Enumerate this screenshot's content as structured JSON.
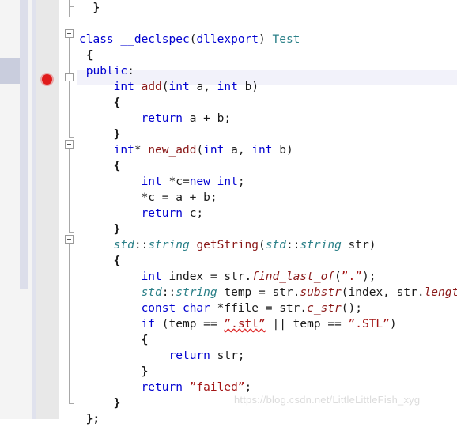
{
  "editor": {
    "app": "visual-studio-code-editor",
    "language": "C++",
    "current_line_index": 4,
    "colors": {
      "background": "#ffffff",
      "keyword": "#0000d0",
      "function_name": "#8b1a1a",
      "class_name": "#2b8088",
      "type_italic": "#2b8088",
      "string": "#a31515",
      "plain": "#1a1a1a",
      "current_line_bg": "#f2f2fa",
      "breakpoint": "#e01b1b",
      "gutter": "#e8e8e8",
      "error_squiggle": "#e03030",
      "watermark": "#dcdcdc"
    }
  },
  "gutter": {
    "breakpoint_tooltip": "Breakpoint",
    "fold_markers": [
      {
        "name": "fold-class-test",
        "label": "-"
      },
      {
        "name": "fold-method-add",
        "label": "-"
      },
      {
        "name": "fold-method-new-add",
        "label": "-"
      },
      {
        "name": "fold-method-getstring",
        "label": "-"
      }
    ]
  },
  "code_lines": [
    {
      "indent": "  ",
      "tokens": [
        {
          "t": "}",
          "c": "brace"
        }
      ]
    },
    {
      "indent": "",
      "tokens": []
    },
    {
      "indent": "",
      "tokens": [
        {
          "t": "class",
          "c": "kw"
        },
        {
          "t": " ",
          "c": "pln"
        },
        {
          "t": "__declspec",
          "c": "kw"
        },
        {
          "t": "(",
          "c": "pln"
        },
        {
          "t": "dllexport",
          "c": "kw"
        },
        {
          "t": ") ",
          "c": "pln"
        },
        {
          "t": "Test",
          "c": "cls"
        }
      ]
    },
    {
      "indent": " ",
      "tokens": [
        {
          "t": "{",
          "c": "brace"
        }
      ]
    },
    {
      "indent": " ",
      "tokens": [
        {
          "t": "public",
          "c": "kw"
        },
        {
          "t": ":",
          "c": "pln"
        }
      ]
    },
    {
      "indent": "     ",
      "tokens": [
        {
          "t": "int",
          "c": "kw"
        },
        {
          "t": " ",
          "c": "pln"
        },
        {
          "t": "add",
          "c": "fn"
        },
        {
          "t": "(",
          "c": "pln"
        },
        {
          "t": "int",
          "c": "kw"
        },
        {
          "t": " a, ",
          "c": "pln"
        },
        {
          "t": "int",
          "c": "kw"
        },
        {
          "t": " b)",
          "c": "pln"
        }
      ]
    },
    {
      "indent": "     ",
      "tokens": [
        {
          "t": "{",
          "c": "brace"
        }
      ]
    },
    {
      "indent": "         ",
      "tokens": [
        {
          "t": "return",
          "c": "kw"
        },
        {
          "t": " a + b;",
          "c": "pln"
        }
      ]
    },
    {
      "indent": "     ",
      "tokens": [
        {
          "t": "}",
          "c": "brace"
        }
      ]
    },
    {
      "indent": "     ",
      "tokens": [
        {
          "t": "int",
          "c": "kw"
        },
        {
          "t": "* ",
          "c": "pln"
        },
        {
          "t": "new_add",
          "c": "fn"
        },
        {
          "t": "(",
          "c": "pln"
        },
        {
          "t": "int",
          "c": "kw"
        },
        {
          "t": " a, ",
          "c": "pln"
        },
        {
          "t": "int",
          "c": "kw"
        },
        {
          "t": " b)",
          "c": "pln"
        }
      ]
    },
    {
      "indent": "     ",
      "tokens": [
        {
          "t": "{",
          "c": "brace"
        }
      ]
    },
    {
      "indent": "         ",
      "tokens": [
        {
          "t": "int",
          "c": "kw"
        },
        {
          "t": " *c=",
          "c": "pln"
        },
        {
          "t": "new",
          "c": "kw"
        },
        {
          "t": " ",
          "c": "pln"
        },
        {
          "t": "int",
          "c": "kw"
        },
        {
          "t": ";",
          "c": "pln"
        }
      ]
    },
    {
      "indent": "         ",
      "tokens": [
        {
          "t": "*c = a + b;",
          "c": "pln"
        }
      ]
    },
    {
      "indent": "         ",
      "tokens": [
        {
          "t": "return",
          "c": "kw"
        },
        {
          "t": " c;",
          "c": "pln"
        }
      ]
    },
    {
      "indent": "     ",
      "tokens": [
        {
          "t": "}",
          "c": "brace"
        }
      ]
    },
    {
      "indent": "     ",
      "tokens": [
        {
          "t": "std",
          "c": "typ"
        },
        {
          "t": "::",
          "c": "pln"
        },
        {
          "t": "string",
          "c": "typ"
        },
        {
          "t": " ",
          "c": "pln"
        },
        {
          "t": "getString",
          "c": "fn"
        },
        {
          "t": "(",
          "c": "pln"
        },
        {
          "t": "std",
          "c": "typ"
        },
        {
          "t": "::",
          "c": "pln"
        },
        {
          "t": "string",
          "c": "typ"
        },
        {
          "t": " str)",
          "c": "pln"
        }
      ]
    },
    {
      "indent": "     ",
      "tokens": [
        {
          "t": "{",
          "c": "brace"
        }
      ]
    },
    {
      "indent": "         ",
      "tokens": [
        {
          "t": "int",
          "c": "kw"
        },
        {
          "t": " index = str.",
          "c": "pln"
        },
        {
          "t": "find_last_of",
          "c": "mth"
        },
        {
          "t": "(",
          "c": "pln"
        },
        {
          "t": "”.”",
          "c": "str"
        },
        {
          "t": ");",
          "c": "pln"
        }
      ]
    },
    {
      "indent": "         ",
      "tokens": [
        {
          "t": "std",
          "c": "typ"
        },
        {
          "t": "::",
          "c": "pln"
        },
        {
          "t": "string",
          "c": "typ"
        },
        {
          "t": " temp = str.",
          "c": "pln"
        },
        {
          "t": "substr",
          "c": "mth"
        },
        {
          "t": "(index, str.",
          "c": "pln"
        },
        {
          "t": "length",
          "c": "mth"
        },
        {
          "t": "());",
          "c": "pln"
        }
      ]
    },
    {
      "indent": "         ",
      "tokens": [
        {
          "t": "const",
          "c": "kw"
        },
        {
          "t": " ",
          "c": "pln"
        },
        {
          "t": "char",
          "c": "kw"
        },
        {
          "t": " *ffile = str.",
          "c": "pln"
        },
        {
          "t": "c_str",
          "c": "mth"
        },
        {
          "t": "();",
          "c": "pln"
        }
      ]
    },
    {
      "indent": "         ",
      "tokens": [
        {
          "t": "if",
          "c": "kw"
        },
        {
          "t": " (temp == ",
          "c": "pln"
        },
        {
          "t": "”.stl”",
          "c": "str squig"
        },
        {
          "t": " || temp == ",
          "c": "pln"
        },
        {
          "t": "”.STL”",
          "c": "str"
        },
        {
          "t": ")",
          "c": "pln"
        }
      ]
    },
    {
      "indent": "         ",
      "tokens": [
        {
          "t": "{",
          "c": "brace"
        }
      ]
    },
    {
      "indent": "             ",
      "tokens": [
        {
          "t": "return",
          "c": "kw"
        },
        {
          "t": " str;",
          "c": "pln"
        }
      ]
    },
    {
      "indent": "         ",
      "tokens": [
        {
          "t": "}",
          "c": "brace"
        }
      ]
    },
    {
      "indent": "         ",
      "tokens": [
        {
          "t": "return",
          "c": "kw"
        },
        {
          "t": " ",
          "c": "pln"
        },
        {
          "t": "”failed”",
          "c": "str"
        },
        {
          "t": ";",
          "c": "pln"
        }
      ]
    },
    {
      "indent": "     ",
      "tokens": [
        {
          "t": "}",
          "c": "brace"
        }
      ]
    },
    {
      "indent": " ",
      "tokens": [
        {
          "t": "};",
          "c": "brace"
        }
      ]
    }
  ],
  "watermark": {
    "text": "https://blog.csdn.net/LittleLittleFish_xyg"
  }
}
